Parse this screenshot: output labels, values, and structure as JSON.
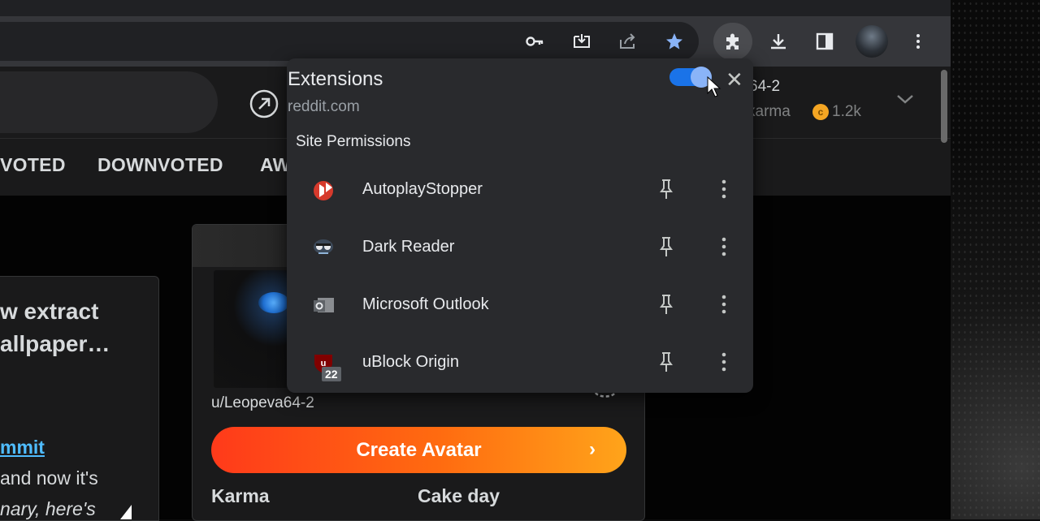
{
  "browser": {
    "toolbar_icons": [
      "key-icon",
      "install-app-icon",
      "share-icon",
      "bookmark-star-icon",
      "extensions-puzzle-icon",
      "download-icon",
      "side-panel-icon",
      "profile-avatar",
      "more-menu-icon"
    ],
    "accent": "#8ab4f8"
  },
  "reddit": {
    "header": {
      "username_partial": "64-2",
      "karma_partial": "karma",
      "coins": "1.2k"
    },
    "tabs": [
      "VOTED",
      "DOWNVOTED",
      "AW"
    ],
    "post": {
      "title": "w extract\nallpaper…",
      "link": "mmit",
      "line1": "and now it's",
      "line2": "nary, here's"
    },
    "profile": {
      "username": "u/Leopeva64-2",
      "create_avatar": "Create Avatar",
      "karma_label": "Karma",
      "cakeday_label": "Cake day"
    }
  },
  "extensions_popup": {
    "title": "Extensions",
    "site": "reddit.com",
    "section": "Site Permissions",
    "site_access_enabled": true,
    "items": [
      {
        "name": "AutoplayStopper",
        "icon": "autoplaystopper-icon"
      },
      {
        "name": "Dark Reader",
        "icon": "dark-reader-icon"
      },
      {
        "name": "Microsoft Outlook",
        "icon": "outlook-icon"
      },
      {
        "name": "uBlock Origin",
        "icon": "ublock-origin-icon",
        "badge": "22"
      }
    ]
  }
}
